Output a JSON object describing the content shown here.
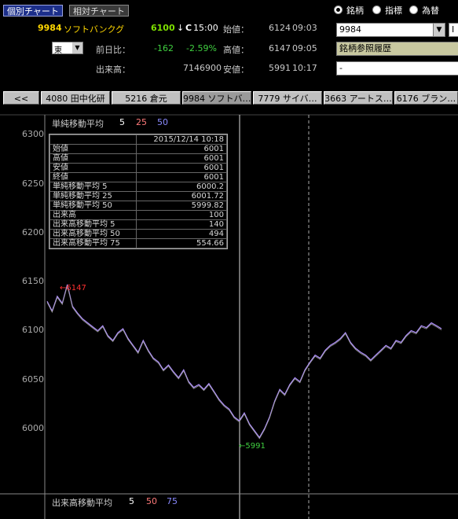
{
  "tabs": {
    "individual": "個別チャート",
    "relative": "相対チャート"
  },
  "radios": [
    {
      "label": "銘柄",
      "selected": true
    },
    {
      "label": "指標",
      "selected": false
    },
    {
      "label": "為替",
      "selected": false
    }
  ],
  "stock": {
    "code": "9984",
    "name": "ソフトバンクグ",
    "price": "6100",
    "arrow": "↓",
    "flag": "C",
    "time": "15:00",
    "market": "東",
    "change_label": "前日比：",
    "change": "-162",
    "change_pct": "-2.59%",
    "volume_label": "出来高：",
    "volume": "7146900"
  },
  "quotes": {
    "open_label": "始値：",
    "open": "6124",
    "open_time": "09:03",
    "high_label": "高値：",
    "high": "6147",
    "high_time": "09:05",
    "low_label": "安値：",
    "low": "5991",
    "low_time": "10:17"
  },
  "search": {
    "code_value": "9984",
    "history_label": "銘柄参照履歴",
    "third_value": "-",
    "right_cut": "I"
  },
  "stock_tabs": [
    "<<",
    "4080 田中化研",
    "5216 倉元",
    "9984 ソフトバ…",
    "7779 サイバ…",
    "3663 アートス…",
    "6176 ブラン…"
  ],
  "chart_data": {
    "type": "line",
    "title": "単純移動平均",
    "ma_periods": [
      "5",
      "25",
      "50"
    ],
    "y_ticks": [
      "6300",
      "6250",
      "6200",
      "6150",
      "6100",
      "6050",
      "6000"
    ],
    "ylim": [
      5980,
      6305
    ],
    "marker_high": "←6147",
    "marker_low": "←5991",
    "series": [
      {
        "values": [
          6130,
          6120,
          6135,
          6128,
          6147,
          6125,
          6118,
          6112,
          6108,
          6104,
          6100,
          6105,
          6095,
          6090,
          6098,
          6102,
          6092,
          6085,
          6078,
          6090,
          6080,
          6072,
          6068,
          6060,
          6065,
          6058,
          6052,
          6060,
          6048,
          6042,
          6045,
          6040,
          6046,
          6038,
          6030,
          6024,
          6020,
          6012,
          6008,
          6016,
          6005,
          5998,
          5991,
          6000,
          6012,
          6028,
          6040,
          6035,
          6045,
          6052,
          6048,
          6060,
          6068,
          6075,
          6072,
          6080,
          6085,
          6088,
          6092,
          6098,
          6088,
          6082,
          6078,
          6075,
          6070,
          6075,
          6080,
          6085,
          6082,
          6090,
          6088,
          6095,
          6100,
          6098,
          6105,
          6103,
          6108,
          6105,
          6102
        ]
      }
    ],
    "volume_title": "出来高移動平均",
    "volume_periods": [
      "5",
      "50",
      "75"
    ]
  },
  "info_box": {
    "datetime": "2015/12/14 10:18",
    "rows": [
      {
        "label": "始値",
        "value": "6001"
      },
      {
        "label": "高値",
        "value": "6001"
      },
      {
        "label": "安値",
        "value": "6001"
      },
      {
        "label": "終値",
        "value": "6001"
      },
      {
        "label": "単純移動平均 5",
        "value": "6000.2"
      },
      {
        "label": "単純移動平均 25",
        "value": "6001.72"
      },
      {
        "label": "単純移動平均 50",
        "value": "5999.82"
      },
      {
        "label": "出来高",
        "value": "100"
      },
      {
        "label": "出来高移動平均 5",
        "value": "140"
      },
      {
        "label": "出来高移動平均 50",
        "value": "494"
      },
      {
        "label": "出来高移動平均 75",
        "value": "554.66"
      }
    ]
  },
  "colors": {
    "ma5": "#ffffff",
    "ma25": "#ff7a7a",
    "ma50": "#8a8aff",
    "price": "#b090ff",
    "high": "#ff3030",
    "low": "#40d040",
    "stock_code": "#ffd700",
    "price_color": "#7ee000"
  }
}
